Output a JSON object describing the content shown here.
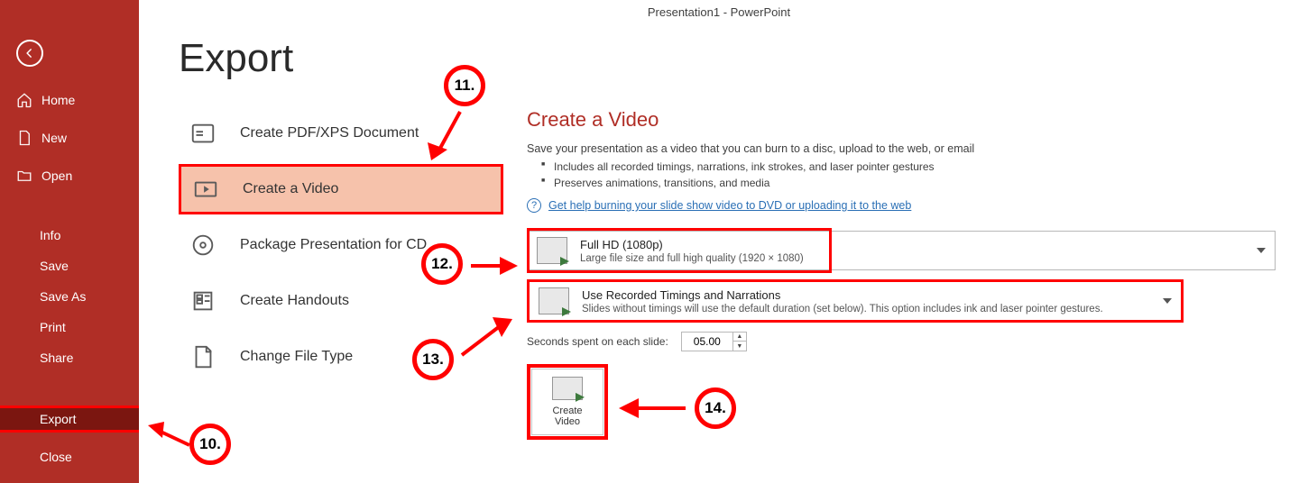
{
  "window": {
    "title": "Presentation1 - PowerPoint"
  },
  "page": {
    "title": "Export"
  },
  "sidebar": {
    "back": "Back",
    "top": [
      {
        "label": "Home",
        "icon": "home"
      },
      {
        "label": "New",
        "icon": "new"
      },
      {
        "label": "Open",
        "icon": "open"
      }
    ],
    "bottom": [
      {
        "label": "Info"
      },
      {
        "label": "Save"
      },
      {
        "label": "Save As"
      },
      {
        "label": "Print"
      },
      {
        "label": "Share"
      },
      {
        "label": "Export",
        "active": true
      },
      {
        "label": "Close"
      }
    ]
  },
  "export_options": [
    {
      "label": "Create PDF/XPS Document",
      "icon": "pdf"
    },
    {
      "label": "Create a Video",
      "icon": "video",
      "selected": true
    },
    {
      "label": "Package Presentation for CD",
      "icon": "cd"
    },
    {
      "label": "Create Handouts",
      "icon": "handouts"
    },
    {
      "label": "Change File Type",
      "icon": "filetype"
    }
  ],
  "video_pane": {
    "heading": "Create a Video",
    "desc": "Save your presentation as a video that you can burn to a disc, upload to the web, or email",
    "bullets": [
      "Includes all recorded timings, narrations, ink strokes, and laser pointer gestures",
      "Preserves animations, transitions, and media"
    ],
    "help_link": "Get help burning your slide show video to DVD or uploading it to the web",
    "quality": {
      "title": "Full HD (1080p)",
      "sub": "Large file size and full high quality (1920 × 1080)"
    },
    "timings": {
      "title": "Use Recorded Timings and Narrations",
      "sub": "Slides without timings will use the default duration (set below). This option includes ink and laser pointer gestures."
    },
    "seconds_label": "Seconds spent on each slide:",
    "seconds_value": "05.00",
    "button_line1": "Create",
    "button_line2": "Video"
  },
  "callouts": {
    "c10": "10.",
    "c11": "11.",
    "c12": "12.",
    "c13": "13.",
    "c14": "14."
  }
}
